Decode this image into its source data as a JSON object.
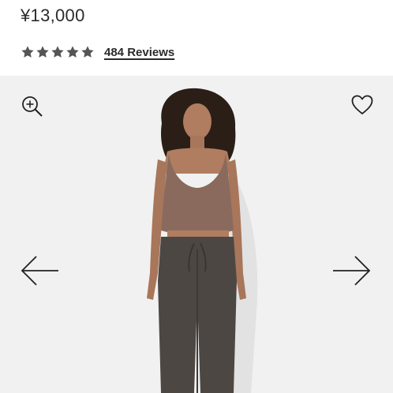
{
  "product": {
    "price": "¥13,000"
  },
  "rating": {
    "stars": 5,
    "reviews_label": "484 Reviews",
    "star_color": "#555555"
  },
  "gallery": {
    "controls": [
      "zoom-icon",
      "heart-icon",
      "arrow-left-icon",
      "arrow-right-icon"
    ],
    "background": "#f1f1f1",
    "top_color": "#8a6a5d",
    "pants_color": "#4d4744"
  }
}
